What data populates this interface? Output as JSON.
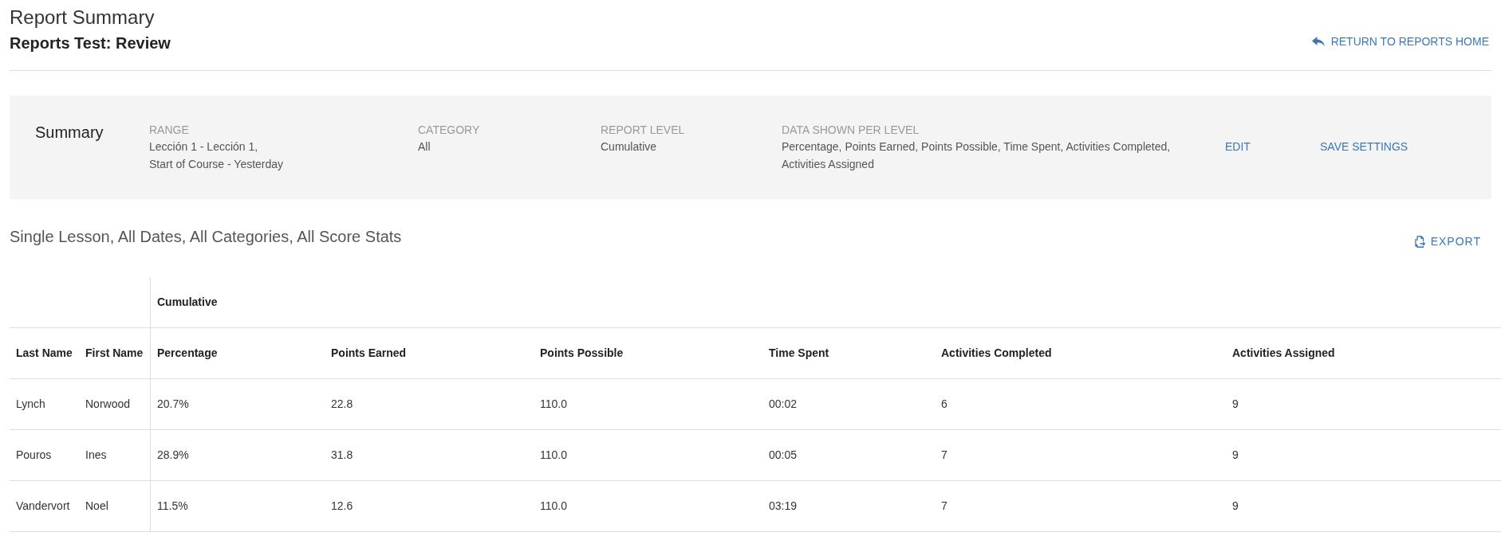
{
  "header": {
    "title": "Report Summary",
    "subtitle": "Reports Test: Review",
    "return_link": "RETURN TO REPORTS HOME"
  },
  "summary": {
    "title": "Summary",
    "fields": [
      {
        "label": "RANGE",
        "lines": [
          "Lección 1 - Lección 1,",
          "Start of Course - Yesterday"
        ]
      },
      {
        "label": "CATEGORY",
        "lines": [
          "All"
        ]
      },
      {
        "label": "REPORT LEVEL",
        "lines": [
          "Cumulative"
        ]
      },
      {
        "label": "DATA SHOWN PER LEVEL",
        "lines": [
          "Percentage, Points Earned, Points Possible, Time Spent, Activities Completed, Activities Assigned"
        ]
      }
    ],
    "actions": [
      "EDIT",
      "SAVE SETTINGS"
    ]
  },
  "report": {
    "title": "Single Lesson, All Dates, All Categories, All Score Stats",
    "export": "EXPORT",
    "table": {
      "group_header": "Cumulative",
      "columns": [
        "Last Name",
        "First Name",
        "Percentage",
        "Points Earned",
        "Points Possible",
        "Time Spent",
        "Activities Completed",
        "Activities Assigned"
      ],
      "rows": [
        [
          "Lynch",
          "Norwood",
          "20.7%",
          "22.8",
          "110.0",
          "00:02",
          "6",
          "9"
        ],
        [
          "Pouros",
          "Ines",
          "28.9%",
          "31.8",
          "110.0",
          "00:05",
          "7",
          "9"
        ],
        [
          "Vandervort",
          "Noel",
          "11.5%",
          "12.6",
          "110.0",
          "03:19",
          "7",
          "9"
        ]
      ]
    }
  }
}
